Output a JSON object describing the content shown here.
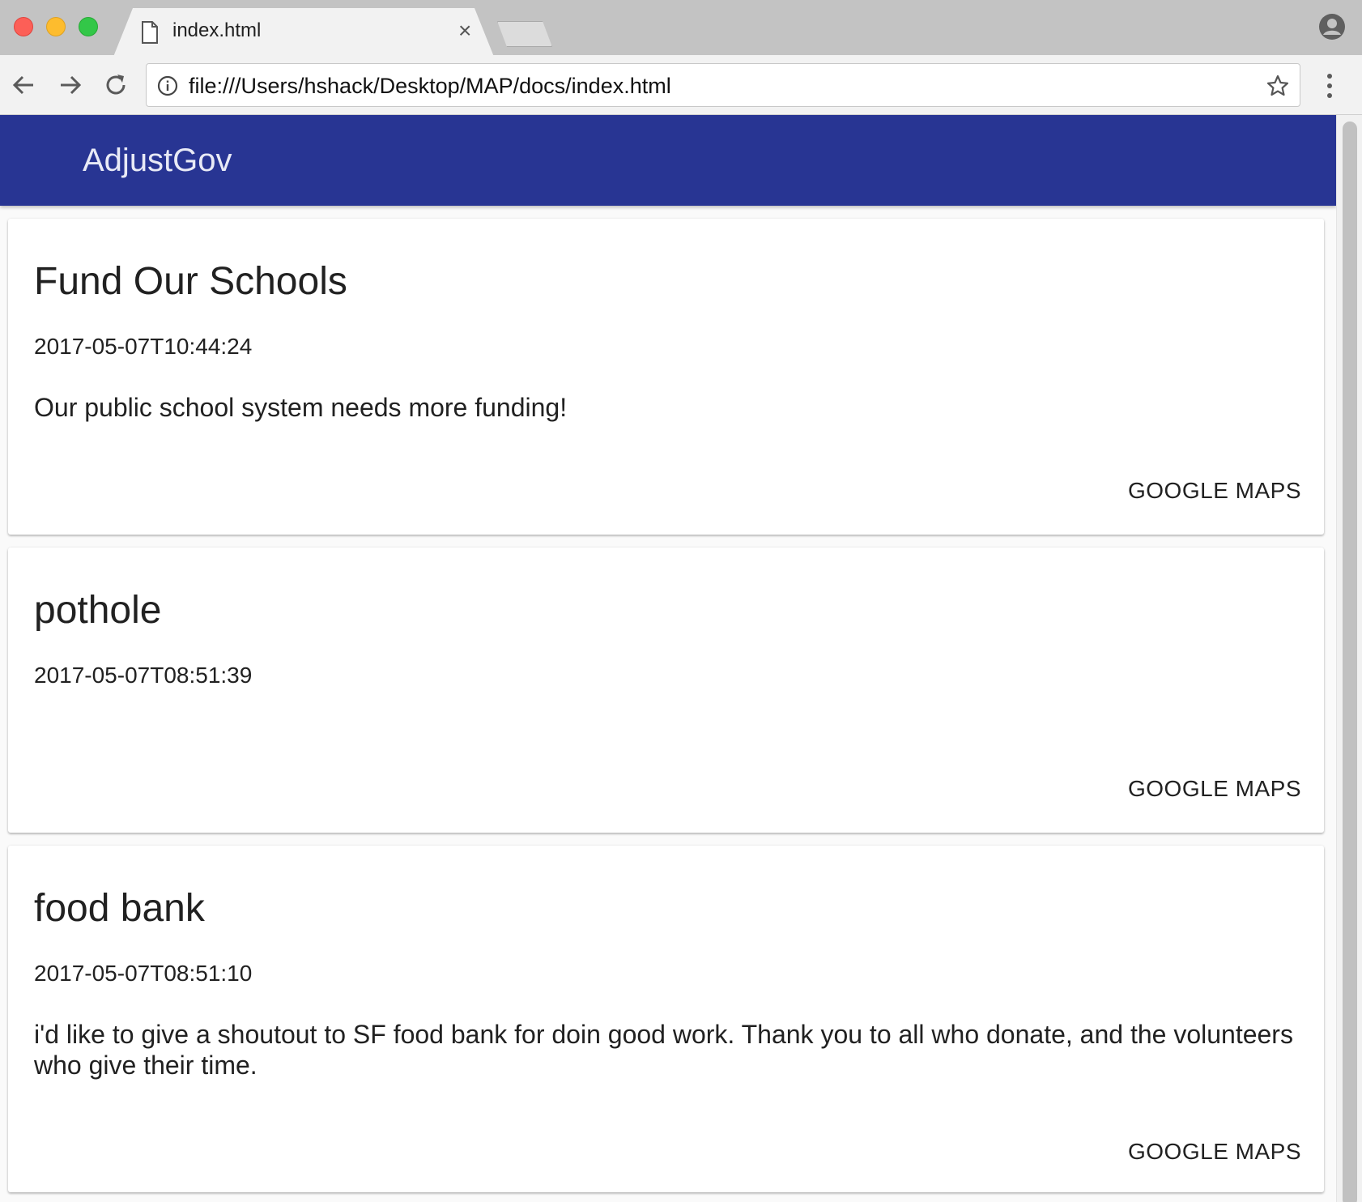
{
  "browser": {
    "tab_title": "index.html",
    "tab_close": "×",
    "url": "file:///Users/hshack/Desktop/MAP/docs/index.html"
  },
  "app": {
    "title": "AdjustGov",
    "header_color": "#283593"
  },
  "cards": [
    {
      "title": "Fund Our Schools",
      "timestamp": "2017-05-07T10:44:24",
      "body": "Our public school system needs more funding!",
      "action_label": "GOOGLE MAPS"
    },
    {
      "title": "pothole",
      "timestamp": "2017-05-07T08:51:39",
      "body": "",
      "action_label": "GOOGLE MAPS"
    },
    {
      "title": "food bank",
      "timestamp": "2017-05-07T08:51:10",
      "body": "i'd like to give a shoutout to SF food bank for doin good work. Thank you to all who donate, and the volunteers who give their time.",
      "action_label": "GOOGLE MAPS"
    }
  ]
}
